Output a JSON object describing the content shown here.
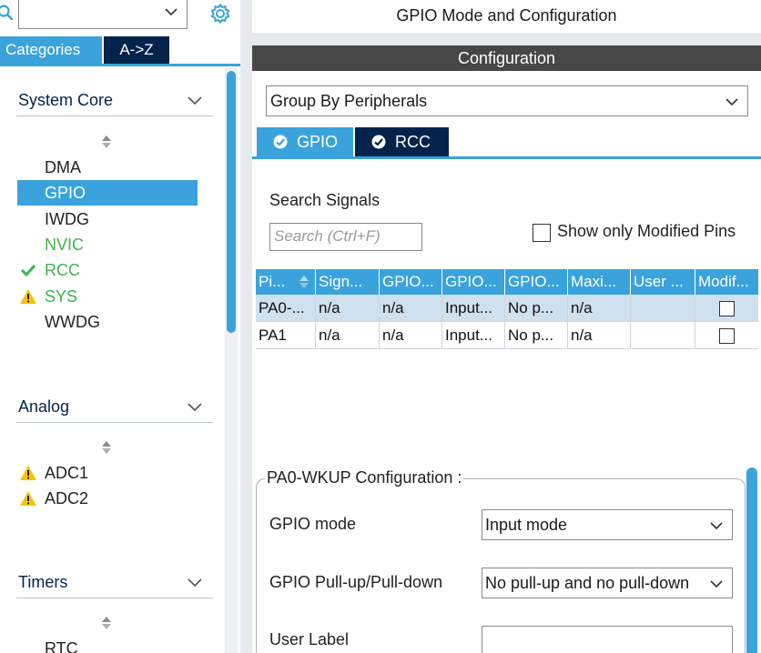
{
  "left_panel": {
    "search": {
      "value": ""
    },
    "tabs": {
      "categories": "Categories",
      "atoz": "A->Z"
    },
    "sections": [
      {
        "title": "System Core",
        "items": [
          {
            "label": "DMA",
            "state": "normal"
          },
          {
            "label": "GPIO",
            "state": "selected"
          },
          {
            "label": "IWDG",
            "state": "normal"
          },
          {
            "label": "NVIC",
            "state": "green"
          },
          {
            "label": "RCC",
            "state": "green-check"
          },
          {
            "label": "SYS",
            "state": "green-warning"
          },
          {
            "label": "WWDG",
            "state": "normal"
          }
        ]
      },
      {
        "title": "Analog",
        "items": [
          {
            "label": "ADC1",
            "state": "warning"
          },
          {
            "label": "ADC2",
            "state": "warning"
          }
        ]
      },
      {
        "title": "Timers",
        "items": [
          {
            "label": "RTC",
            "state": "normal"
          }
        ]
      }
    ]
  },
  "right_panel": {
    "header": "GPIO Mode and Configuration",
    "config_title": "Configuration",
    "group_select": "Group By Peripherals",
    "peripheral_tabs": [
      {
        "label": "GPIO",
        "active": true
      },
      {
        "label": "RCC",
        "active": false
      }
    ],
    "search_signals_label": "Search Signals",
    "search_placeholder": "Search (Ctrl+F)",
    "show_modified_label": "Show only Modified Pins",
    "table": {
      "columns": [
        "Pi...",
        "Sign...",
        "GPIO...",
        "GPIO...",
        "GPIO...",
        "Maxi...",
        "User ...",
        "Modif..."
      ],
      "rows": [
        [
          "PA0-...",
          "n/a",
          "n/a",
          "Input...",
          "No p...",
          "n/a",
          "",
          ""
        ],
        [
          "PA1",
          "n/a",
          "n/a",
          "Input...",
          "No p...",
          "n/a",
          "",
          ""
        ]
      ]
    },
    "pin_config": {
      "legend": "PA0-WKUP Configuration :",
      "fields": [
        {
          "label": "GPIO mode",
          "value": "Input mode"
        },
        {
          "label": "GPIO Pull-up/Pull-down",
          "value": "No pull-up and no pull-down"
        },
        {
          "label": "User Label",
          "value": ""
        }
      ]
    }
  },
  "colors": {
    "accent": "#3aa3db",
    "dark_navy": "#03234b",
    "config_bar": "#474747",
    "green": "#3db44a",
    "warning": "#f5c400"
  }
}
